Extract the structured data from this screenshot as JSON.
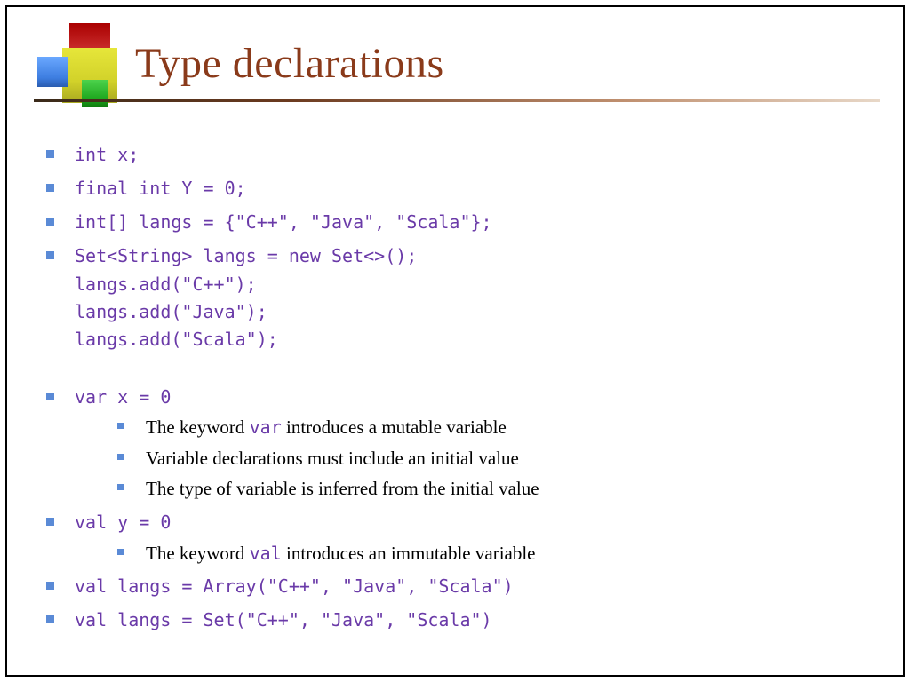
{
  "title": "Type declarations",
  "bullets": {
    "b1": "int x;",
    "b2": "final int Y = 0;",
    "b3": "int[] langs = {\"C++\", \"Java\", \"Scala\"};",
    "b4_line1": "Set<String> langs = new Set<>();",
    "b4_line2": "langs.add(\"C++\");",
    "b4_line3": "langs.add(\"Java\");",
    "b4_line4": "langs.add(\"Scala\");",
    "b5": "var x = 0",
    "b5_s1_pre": "The keyword ",
    "b5_s1_code": "var",
    "b5_s1_post": " introduces a mutable variable",
    "b5_s2": "Variable declarations must include an initial value",
    "b5_s3": "The type of variable is inferred from the initial value",
    "b6": "val y = 0",
    "b6_s1_pre": "The keyword ",
    "b6_s1_code": "val",
    "b6_s1_post": " introduces an immutable variable",
    "b7": "val langs = Array(\"C++\", \"Java\", \"Scala\")",
    "b8": "val langs = Set(\"C++\", \"Java\", \"Scala\")"
  }
}
